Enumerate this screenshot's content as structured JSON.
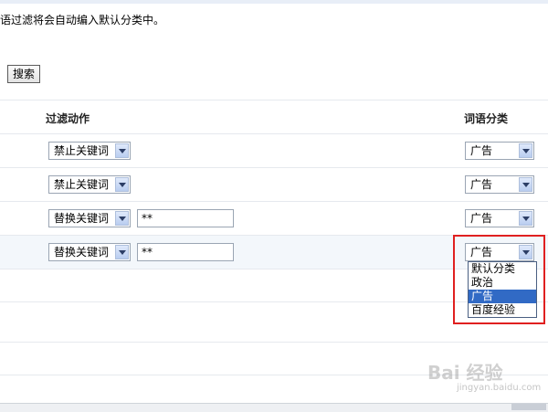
{
  "notice": "语过滤将会自动编入默认分类中。",
  "search_button": "搜索",
  "columns": {
    "action": "过滤动作",
    "category": "词语分类"
  },
  "rows": [
    {
      "action": "禁止关键词",
      "replacement": null,
      "category": "广告"
    },
    {
      "action": "禁止关键词",
      "replacement": null,
      "category": "广告"
    },
    {
      "action": "替换关键词",
      "replacement": "**",
      "category": "广告"
    },
    {
      "action": "替换关键词",
      "replacement": "**",
      "category": "广告"
    }
  ],
  "dropdown_options": [
    "默认分类",
    "政治",
    "广告",
    "百度经验"
  ],
  "dropdown_selected": "广告",
  "watermark": {
    "brand": "Bai 经验",
    "url": "jingyan.baidu.com"
  },
  "colors": {
    "highlight": "#316ac5",
    "annotation": "#e02020"
  }
}
